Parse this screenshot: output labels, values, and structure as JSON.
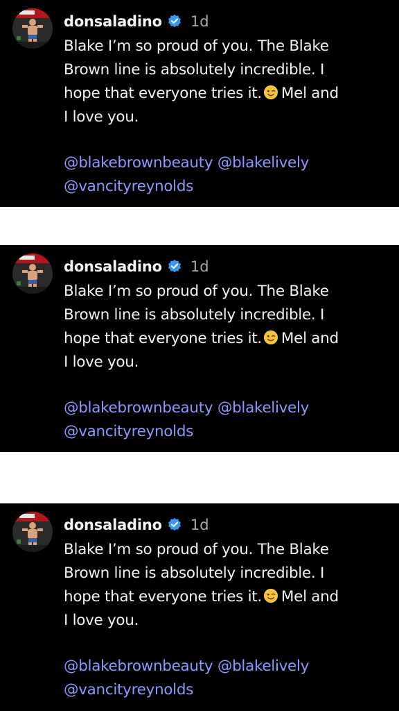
{
  "comments": [
    {
      "username": "donsaladino",
      "time": "1d",
      "text_lines": [
        "Blake I’m so proud of you. The Blake",
        "Brown line is absolutely incredible. I",
        "hope that everyone tries it.",
        "Mel and",
        "I love you."
      ],
      "mentions": [
        "@blakebrownbeauty",
        "@blakelively",
        "@vancityreynolds"
      ],
      "icons": {
        "verified": "verified-badge-icon",
        "emoji": "winking-face-emoji"
      }
    },
    {
      "username": "donsaladino",
      "time": "1d",
      "text_lines": [
        "Blake I’m so proud of you. The Blake",
        "Brown line is absolutely incredible. I",
        "hope that everyone tries it.",
        "Mel and",
        "I love you."
      ],
      "mentions": [
        "@blakebrownbeauty",
        "@blakelively",
        "@vancityreynolds"
      ],
      "icons": {
        "verified": "verified-badge-icon",
        "emoji": "winking-face-emoji"
      }
    },
    {
      "username": "donsaladino",
      "time": "1d",
      "text_lines": [
        "Blake I’m so proud of you. The Blake",
        "Brown line is absolutely incredible. I",
        "hope that everyone tries it.",
        "Mel and",
        "I love you."
      ],
      "mentions": [
        "@blakebrownbeauty",
        "@blakelively",
        "@vancityreynolds"
      ],
      "icons": {
        "verified": "verified-badge-icon",
        "emoji": "winking-face-emoji"
      }
    }
  ],
  "colors": {
    "background": "#000000",
    "separator": "#ffffff",
    "text": "#f2f2f2",
    "timestamp": "#a8a8a8",
    "mention": "#8e97ff",
    "verified": "#3897f0"
  }
}
